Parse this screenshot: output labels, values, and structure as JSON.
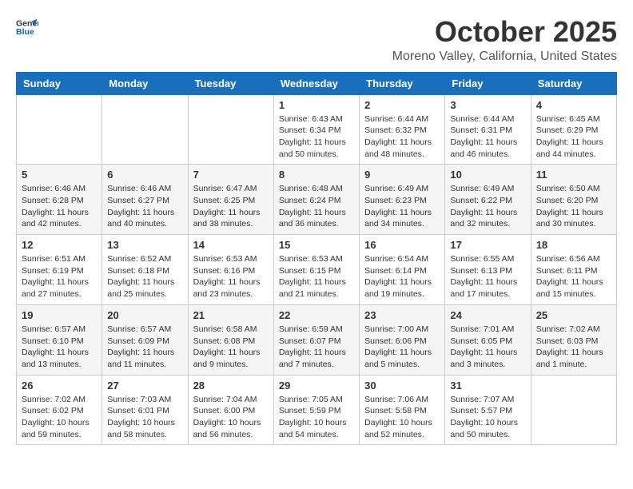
{
  "header": {
    "logo_line1": "General",
    "logo_line2": "Blue",
    "month": "October 2025",
    "location": "Moreno Valley, California, United States"
  },
  "weekdays": [
    "Sunday",
    "Monday",
    "Tuesday",
    "Wednesday",
    "Thursday",
    "Friday",
    "Saturday"
  ],
  "weeks": [
    [
      {
        "day": "",
        "info": ""
      },
      {
        "day": "",
        "info": ""
      },
      {
        "day": "",
        "info": ""
      },
      {
        "day": "1",
        "info": "Sunrise: 6:43 AM\nSunset: 6:34 PM\nDaylight: 11 hours and 50 minutes."
      },
      {
        "day": "2",
        "info": "Sunrise: 6:44 AM\nSunset: 6:32 PM\nDaylight: 11 hours and 48 minutes."
      },
      {
        "day": "3",
        "info": "Sunrise: 6:44 AM\nSunset: 6:31 PM\nDaylight: 11 hours and 46 minutes."
      },
      {
        "day": "4",
        "info": "Sunrise: 6:45 AM\nSunset: 6:29 PM\nDaylight: 11 hours and 44 minutes."
      }
    ],
    [
      {
        "day": "5",
        "info": "Sunrise: 6:46 AM\nSunset: 6:28 PM\nDaylight: 11 hours and 42 minutes."
      },
      {
        "day": "6",
        "info": "Sunrise: 6:46 AM\nSunset: 6:27 PM\nDaylight: 11 hours and 40 minutes."
      },
      {
        "day": "7",
        "info": "Sunrise: 6:47 AM\nSunset: 6:25 PM\nDaylight: 11 hours and 38 minutes."
      },
      {
        "day": "8",
        "info": "Sunrise: 6:48 AM\nSunset: 6:24 PM\nDaylight: 11 hours and 36 minutes."
      },
      {
        "day": "9",
        "info": "Sunrise: 6:49 AM\nSunset: 6:23 PM\nDaylight: 11 hours and 34 minutes."
      },
      {
        "day": "10",
        "info": "Sunrise: 6:49 AM\nSunset: 6:22 PM\nDaylight: 11 hours and 32 minutes."
      },
      {
        "day": "11",
        "info": "Sunrise: 6:50 AM\nSunset: 6:20 PM\nDaylight: 11 hours and 30 minutes."
      }
    ],
    [
      {
        "day": "12",
        "info": "Sunrise: 6:51 AM\nSunset: 6:19 PM\nDaylight: 11 hours and 27 minutes."
      },
      {
        "day": "13",
        "info": "Sunrise: 6:52 AM\nSunset: 6:18 PM\nDaylight: 11 hours and 25 minutes."
      },
      {
        "day": "14",
        "info": "Sunrise: 6:53 AM\nSunset: 6:16 PM\nDaylight: 11 hours and 23 minutes."
      },
      {
        "day": "15",
        "info": "Sunrise: 6:53 AM\nSunset: 6:15 PM\nDaylight: 11 hours and 21 minutes."
      },
      {
        "day": "16",
        "info": "Sunrise: 6:54 AM\nSunset: 6:14 PM\nDaylight: 11 hours and 19 minutes."
      },
      {
        "day": "17",
        "info": "Sunrise: 6:55 AM\nSunset: 6:13 PM\nDaylight: 11 hours and 17 minutes."
      },
      {
        "day": "18",
        "info": "Sunrise: 6:56 AM\nSunset: 6:11 PM\nDaylight: 11 hours and 15 minutes."
      }
    ],
    [
      {
        "day": "19",
        "info": "Sunrise: 6:57 AM\nSunset: 6:10 PM\nDaylight: 11 hours and 13 minutes."
      },
      {
        "day": "20",
        "info": "Sunrise: 6:57 AM\nSunset: 6:09 PM\nDaylight: 11 hours and 11 minutes."
      },
      {
        "day": "21",
        "info": "Sunrise: 6:58 AM\nSunset: 6:08 PM\nDaylight: 11 hours and 9 minutes."
      },
      {
        "day": "22",
        "info": "Sunrise: 6:59 AM\nSunset: 6:07 PM\nDaylight: 11 hours and 7 minutes."
      },
      {
        "day": "23",
        "info": "Sunrise: 7:00 AM\nSunset: 6:06 PM\nDaylight: 11 hours and 5 minutes."
      },
      {
        "day": "24",
        "info": "Sunrise: 7:01 AM\nSunset: 6:05 PM\nDaylight: 11 hours and 3 minutes."
      },
      {
        "day": "25",
        "info": "Sunrise: 7:02 AM\nSunset: 6:03 PM\nDaylight: 11 hours and 1 minute."
      }
    ],
    [
      {
        "day": "26",
        "info": "Sunrise: 7:02 AM\nSunset: 6:02 PM\nDaylight: 10 hours and 59 minutes."
      },
      {
        "day": "27",
        "info": "Sunrise: 7:03 AM\nSunset: 6:01 PM\nDaylight: 10 hours and 58 minutes."
      },
      {
        "day": "28",
        "info": "Sunrise: 7:04 AM\nSunset: 6:00 PM\nDaylight: 10 hours and 56 minutes."
      },
      {
        "day": "29",
        "info": "Sunrise: 7:05 AM\nSunset: 5:59 PM\nDaylight: 10 hours and 54 minutes."
      },
      {
        "day": "30",
        "info": "Sunrise: 7:06 AM\nSunset: 5:58 PM\nDaylight: 10 hours and 52 minutes."
      },
      {
        "day": "31",
        "info": "Sunrise: 7:07 AM\nSunset: 5:57 PM\nDaylight: 10 hours and 50 minutes."
      },
      {
        "day": "",
        "info": ""
      }
    ]
  ]
}
